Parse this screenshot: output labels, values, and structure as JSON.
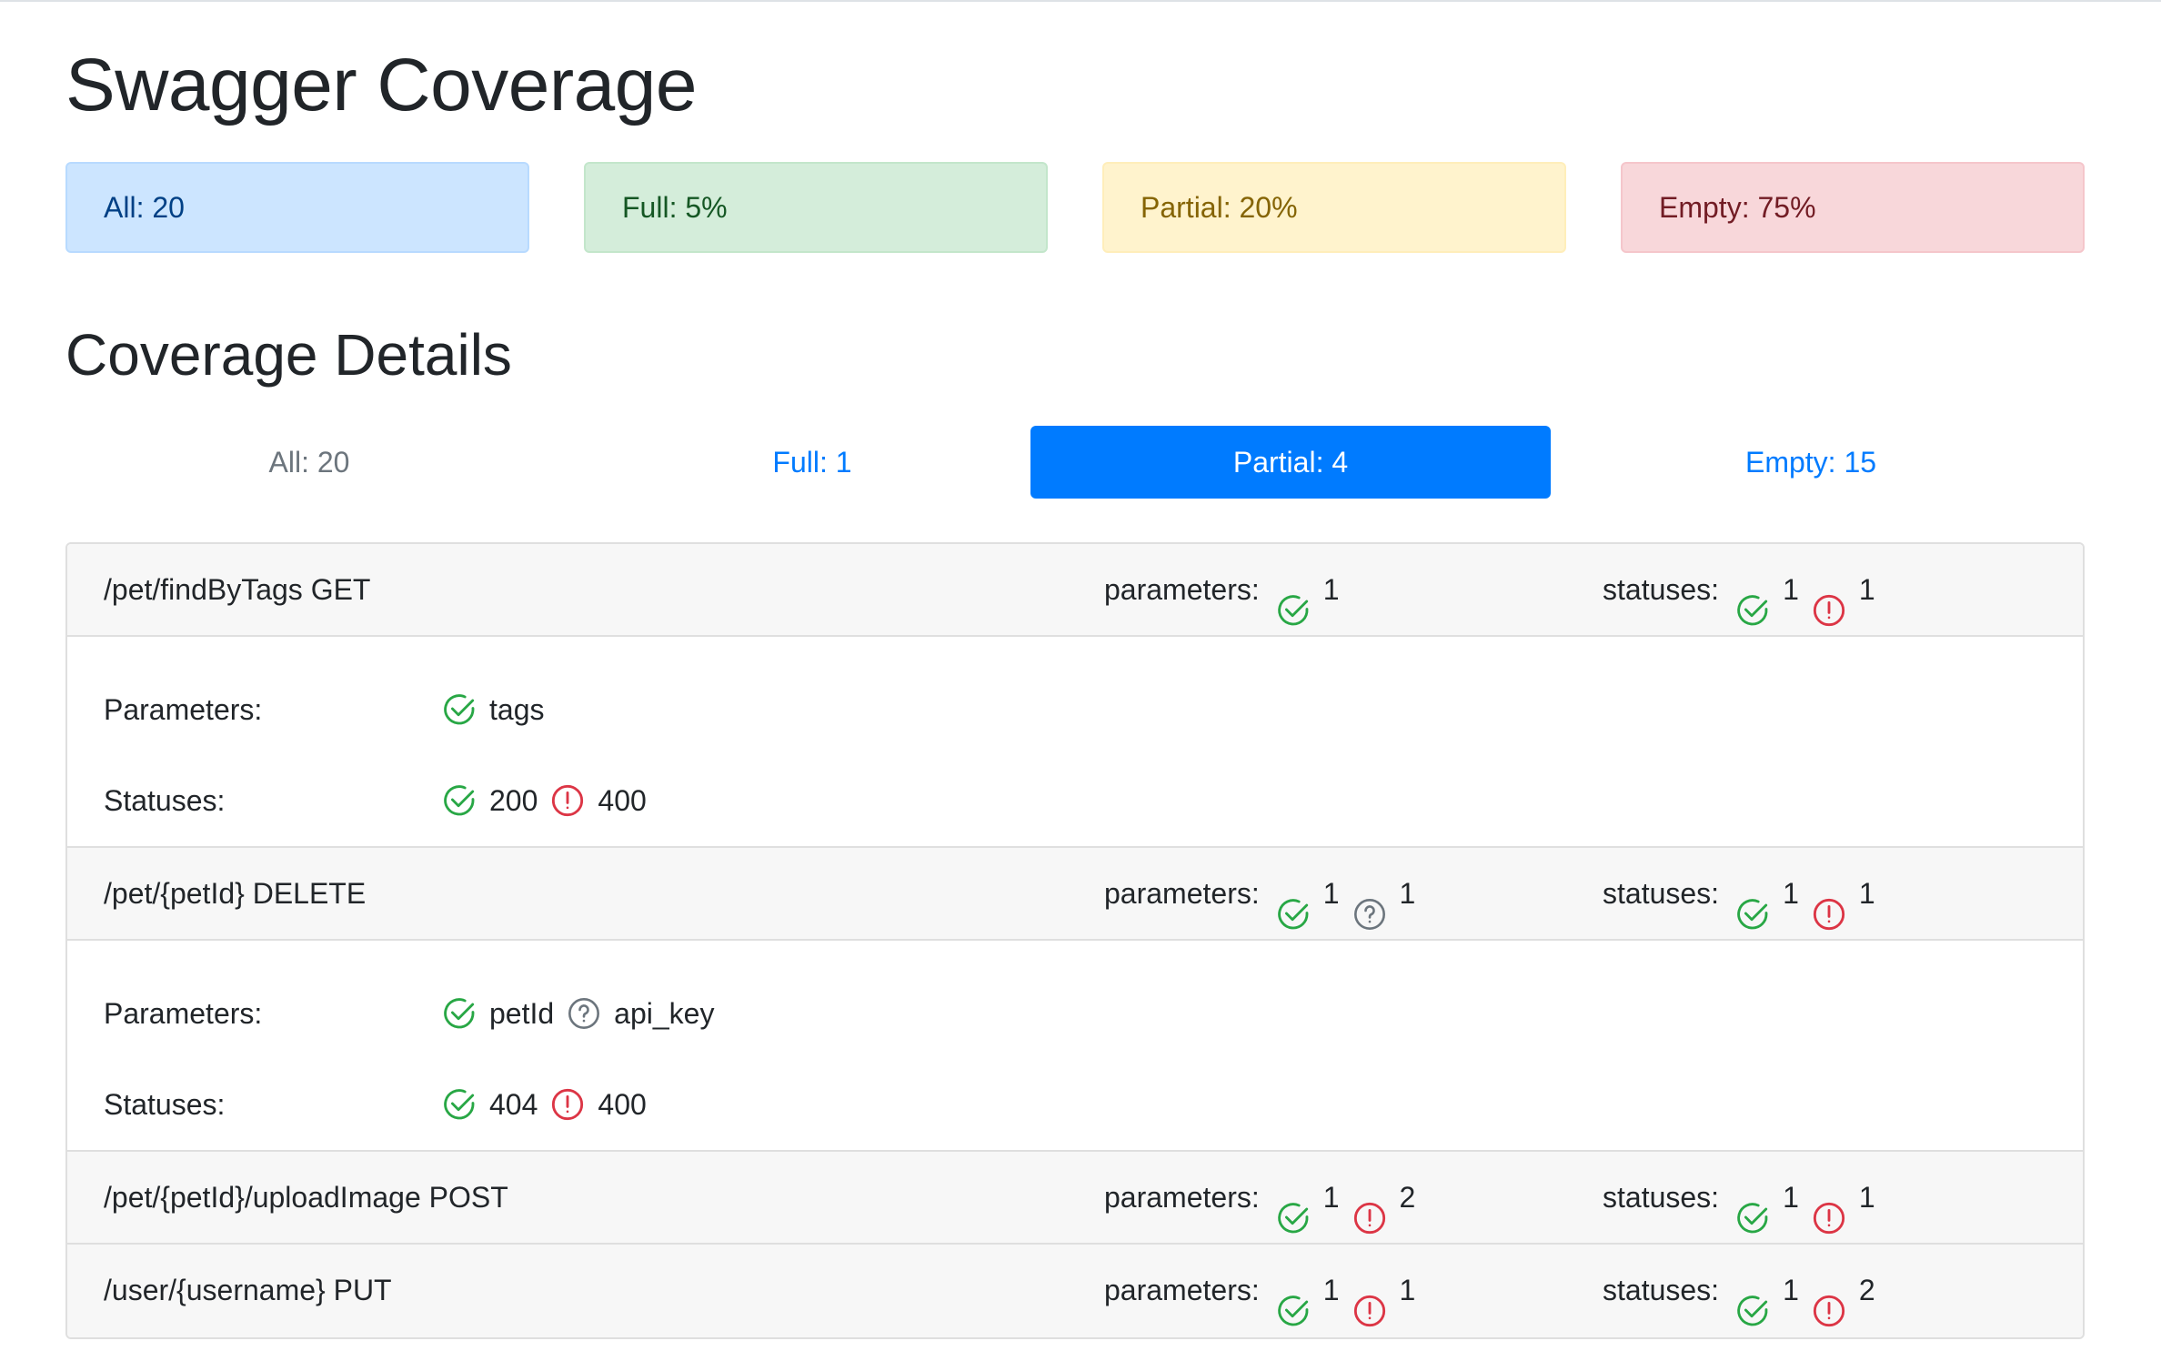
{
  "page_title": "Swagger Coverage",
  "summary": {
    "all": "All: 20",
    "full": "Full: 5%",
    "partial": "Partial: 20%",
    "empty": "Empty: 75%"
  },
  "details_title": "Coverage Details",
  "tabs": {
    "all": "All: 20",
    "full": "Full: 1",
    "partial": "Partial: 4",
    "empty": "Empty: 15",
    "active": "partial"
  },
  "labels": {
    "parameters": "parameters:",
    "statuses": "statuses:",
    "parameters_detail": "Parameters:",
    "statuses_detail": "Statuses:"
  },
  "icons": {
    "covered": "check-circle-icon",
    "uncovered": "exclamation-circle-icon",
    "unknown": "question-circle-icon"
  },
  "colors": {
    "covered": "#28a745",
    "uncovered": "#dc3545",
    "unknown": "#6c757d",
    "accent": "#007bff"
  },
  "operations": [
    {
      "path": "/pet/findByTags GET",
      "params_covered": "1",
      "params_uncovered": "",
      "params_unknown": "",
      "statuses_covered": "1",
      "statuses_uncovered": "1",
      "expanded": true,
      "detail_params": [
        {
          "status": "covered",
          "name": "tags"
        }
      ],
      "detail_statuses": [
        {
          "status": "covered",
          "name": "200"
        },
        {
          "status": "uncovered",
          "name": "400"
        }
      ]
    },
    {
      "path": "/pet/{petId} DELETE",
      "params_covered": "1",
      "params_uncovered": "",
      "params_unknown": "1",
      "statuses_covered": "1",
      "statuses_uncovered": "1",
      "expanded": true,
      "detail_params": [
        {
          "status": "covered",
          "name": "petId"
        },
        {
          "status": "unknown",
          "name": "api_key"
        }
      ],
      "detail_statuses": [
        {
          "status": "covered",
          "name": "404"
        },
        {
          "status": "uncovered",
          "name": "400"
        }
      ]
    },
    {
      "path": "/pet/{petId}/uploadImage POST",
      "params_covered": "1",
      "params_uncovered": "2",
      "params_unknown": "",
      "statuses_covered": "1",
      "statuses_uncovered": "1",
      "expanded": false
    },
    {
      "path": "/user/{username} PUT",
      "params_covered": "1",
      "params_uncovered": "1",
      "params_unknown": "",
      "statuses_covered": "1",
      "statuses_uncovered": "2",
      "expanded": false
    }
  ]
}
